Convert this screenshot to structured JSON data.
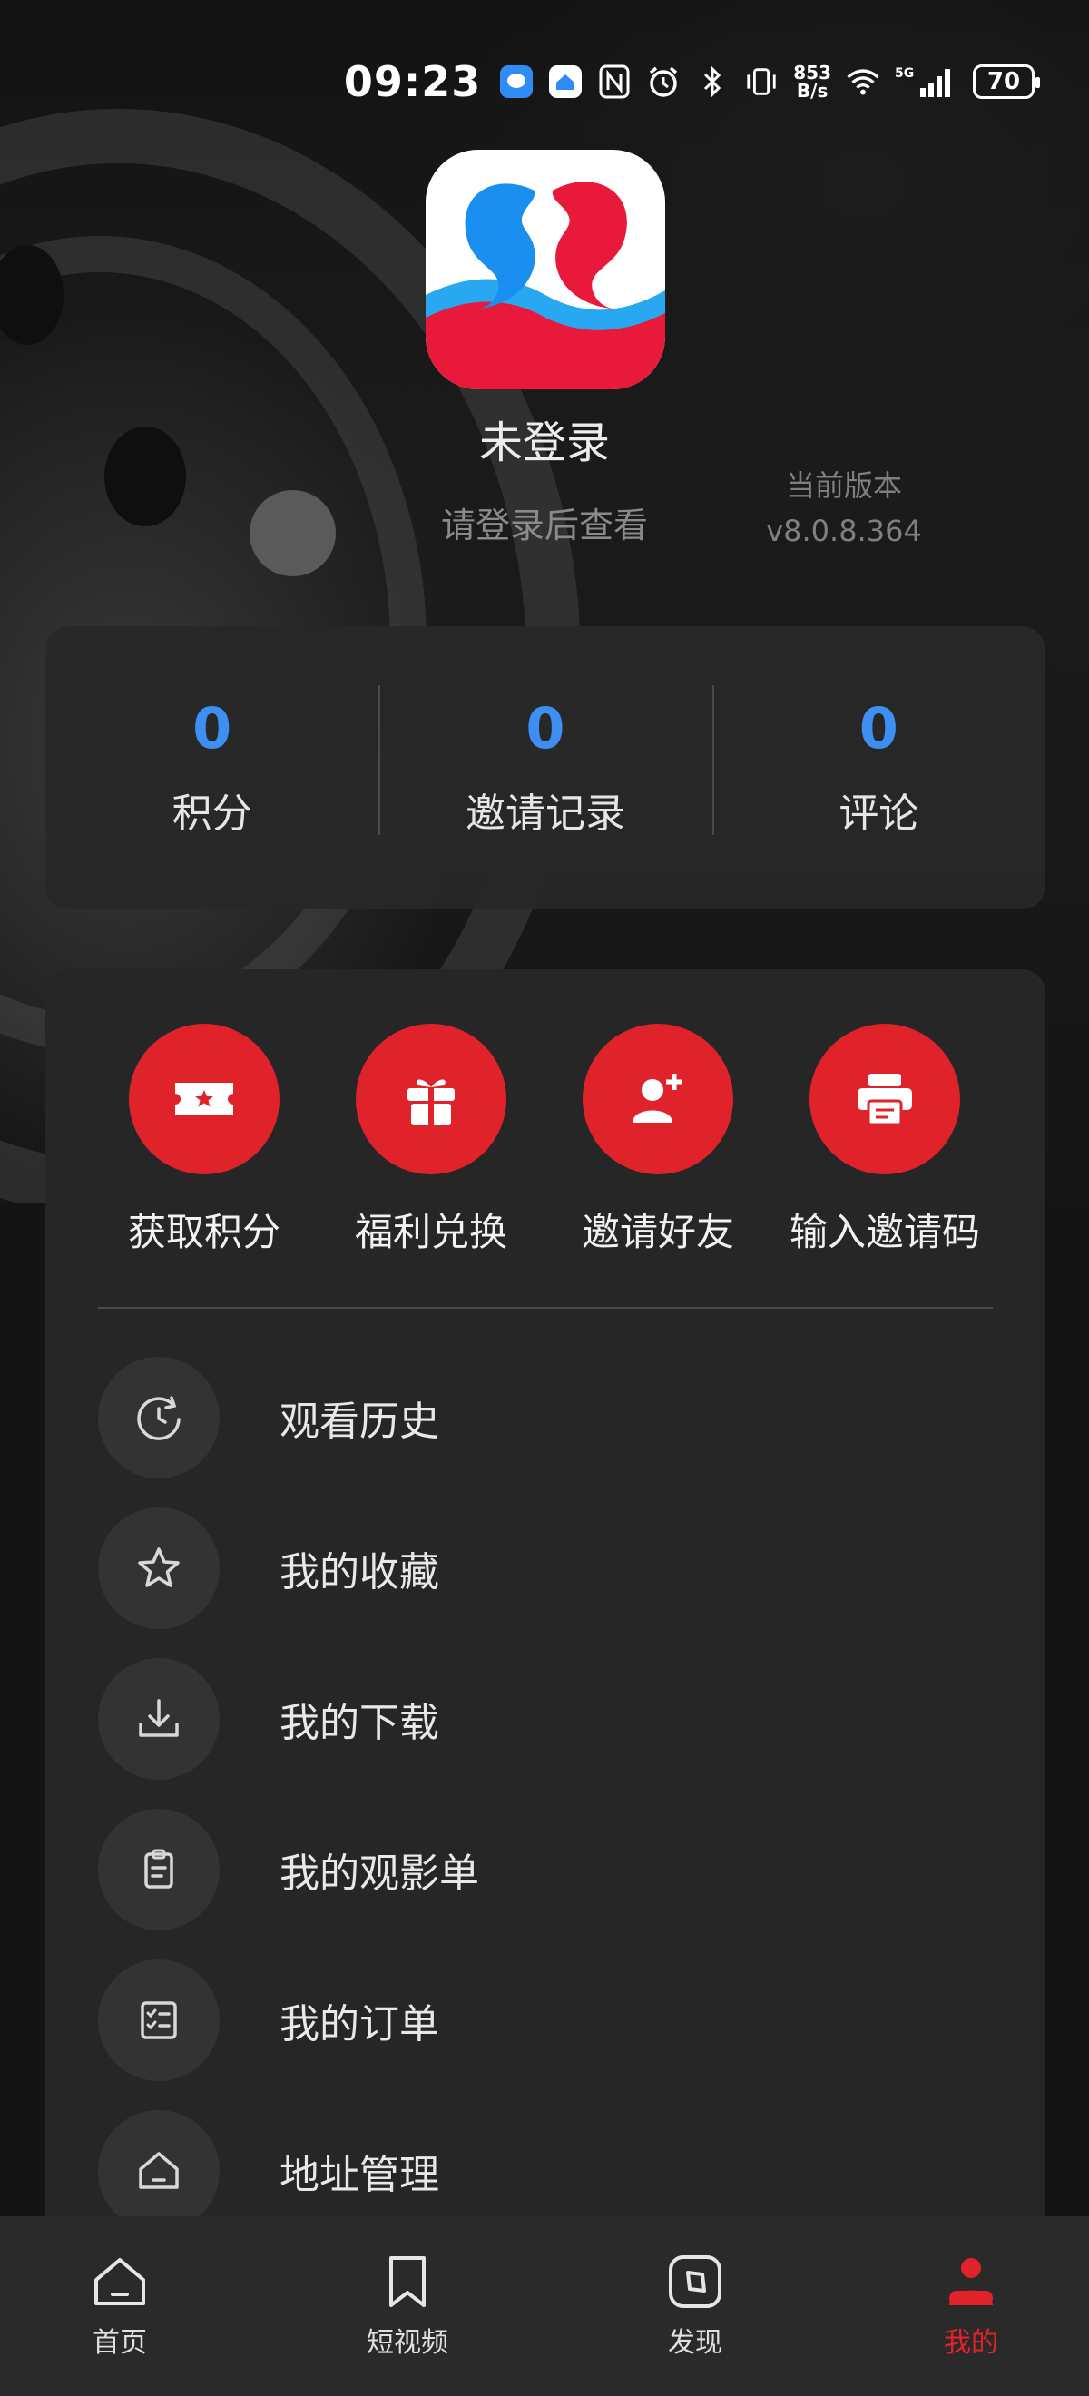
{
  "status_bar": {
    "time": "09:23",
    "net_speed_value": "853",
    "net_speed_unit": "B/s",
    "network": "5G",
    "battery": "70"
  },
  "profile": {
    "username": "未登录",
    "login_hint": "请登录后查看",
    "version_label": "当前版本",
    "version_value": "v8.0.8.364"
  },
  "stats": [
    {
      "value": "0",
      "label": "积分"
    },
    {
      "value": "0",
      "label": "邀请记录"
    },
    {
      "value": "0",
      "label": "评论"
    }
  ],
  "quick_actions": [
    {
      "label": "获取积分",
      "icon": "ticket-icon"
    },
    {
      "label": "福利兑换",
      "icon": "gift-icon"
    },
    {
      "label": "邀请好友",
      "icon": "add-friend-icon"
    },
    {
      "label": "输入邀请码",
      "icon": "printer-icon"
    }
  ],
  "menu_items": [
    {
      "label": "观看历史",
      "icon": "history-icon"
    },
    {
      "label": "我的收藏",
      "icon": "star-icon"
    },
    {
      "label": "我的下载",
      "icon": "download-icon"
    },
    {
      "label": "我的观影单",
      "icon": "clipboard-icon"
    },
    {
      "label": "我的订单",
      "icon": "checklist-icon"
    },
    {
      "label": "地址管理",
      "icon": "home-icon"
    }
  ],
  "bottom_nav": [
    {
      "label": "首页",
      "icon": "home-icon"
    },
    {
      "label": "短视频",
      "icon": "bookmark-icon"
    },
    {
      "label": "发现",
      "icon": "compass-icon"
    },
    {
      "label": "我的",
      "icon": "person-icon",
      "active": true
    }
  ],
  "colors": {
    "accent": "#e0232b",
    "stat_value": "#3d8ff2",
    "card": "#262626"
  }
}
